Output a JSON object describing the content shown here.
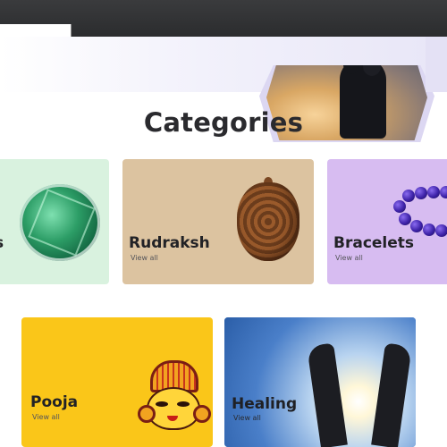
{
  "categories_section": {
    "heading": "Categories"
  },
  "cards": [
    {
      "title": "s",
      "link": ""
    },
    {
      "title": "Rudraksh",
      "link": "View all"
    },
    {
      "title": "Bracelets",
      "link": "View all"
    },
    {
      "title": "Pooja",
      "link": "View all"
    },
    {
      "title": "Healing",
      "link": "View all"
    }
  ],
  "colors": {
    "topbar": "#2b2c2e",
    "gemstone_card": "#d9f2df",
    "rudraksh_card": "#dcc3a0",
    "bracelets_card": "#d7bcf1",
    "pooja_card": "#fac619",
    "healing_card": "#4a7fc9"
  },
  "images": {
    "hero": "couple-sunset-photo",
    "gemstone": "emerald-gem",
    "rudraksh": "rudraksh-bead",
    "bracelets": "amethyst-bead-bracelet",
    "pooja": "durga-illustration",
    "healing": "hands-light-photo"
  }
}
